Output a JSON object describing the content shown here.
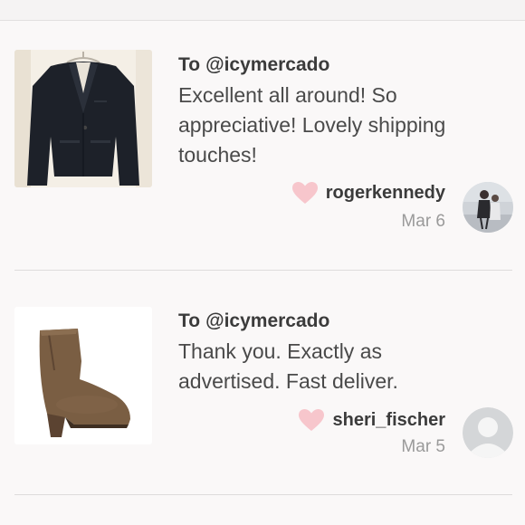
{
  "reviews": [
    {
      "to_prefix": "To",
      "to_handle": "@icymercado",
      "text": "Excellent all around! So appreciative! Lovely shipping touches!",
      "author": "rogerkennedy",
      "date": "Mar 6",
      "item_icon": "blazer-photo",
      "avatar_icon": "user-photo"
    },
    {
      "to_prefix": "To",
      "to_handle": "@icymercado",
      "text": "Thank you. Exactly as advertised. Fast deliver.",
      "author": "sheri_fischer",
      "date": "Mar 5",
      "item_icon": "ankle-boot-photo",
      "avatar_icon": "default-avatar"
    }
  ],
  "colors": {
    "heart": "#f7c6cc",
    "background": "#faf8f8",
    "divider": "#dedcdc",
    "date": "#9a9a9a"
  }
}
